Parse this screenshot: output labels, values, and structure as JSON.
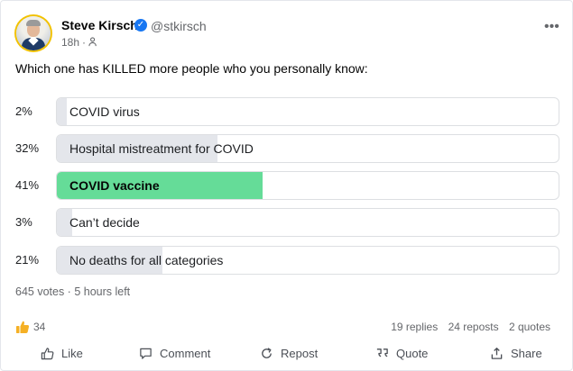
{
  "post": {
    "author_name": "Steve Kirsch",
    "handle": "@stkirsch",
    "time": "18h",
    "question": "Which one has KILLED more people who you personally know:"
  },
  "poll": {
    "options": [
      {
        "label": "COVID virus",
        "percent_text": "2%",
        "percent": 2,
        "winner": false
      },
      {
        "label": "Hospital mistreatment for COVID",
        "percent_text": "32%",
        "percent": 32,
        "winner": false
      },
      {
        "label": "COVID vaccine",
        "percent_text": "41%",
        "percent": 41,
        "winner": true
      },
      {
        "label": "Can’t decide",
        "percent_text": "3%",
        "percent": 3,
        "winner": false
      },
      {
        "label": "No deaths for all categories",
        "percent_text": "21%",
        "percent": 21,
        "winner": false
      }
    ],
    "votes_text": "645 votes · 5 hours left"
  },
  "stats": {
    "likes_count": "34",
    "replies": "19 replies",
    "reposts": "24 reposts",
    "quotes": "2 quotes"
  },
  "actions": {
    "like": "Like",
    "comment": "Comment",
    "repost": "Repost",
    "quote": "Quote",
    "share": "Share"
  },
  "colors": {
    "winner_fill": "#65dc98",
    "default_fill": "#e4e6eb",
    "verified": "#1877f2",
    "avatar_ring": "#f2c200"
  },
  "icons": {
    "verified": "verified-badge-icon",
    "privacy": "people-icon",
    "more": "more-dots-icon",
    "like": "thumbs-up-icon",
    "comment": "comment-bubble-icon",
    "repost": "repost-icon",
    "quote": "quote-icon",
    "share": "share-icon"
  }
}
